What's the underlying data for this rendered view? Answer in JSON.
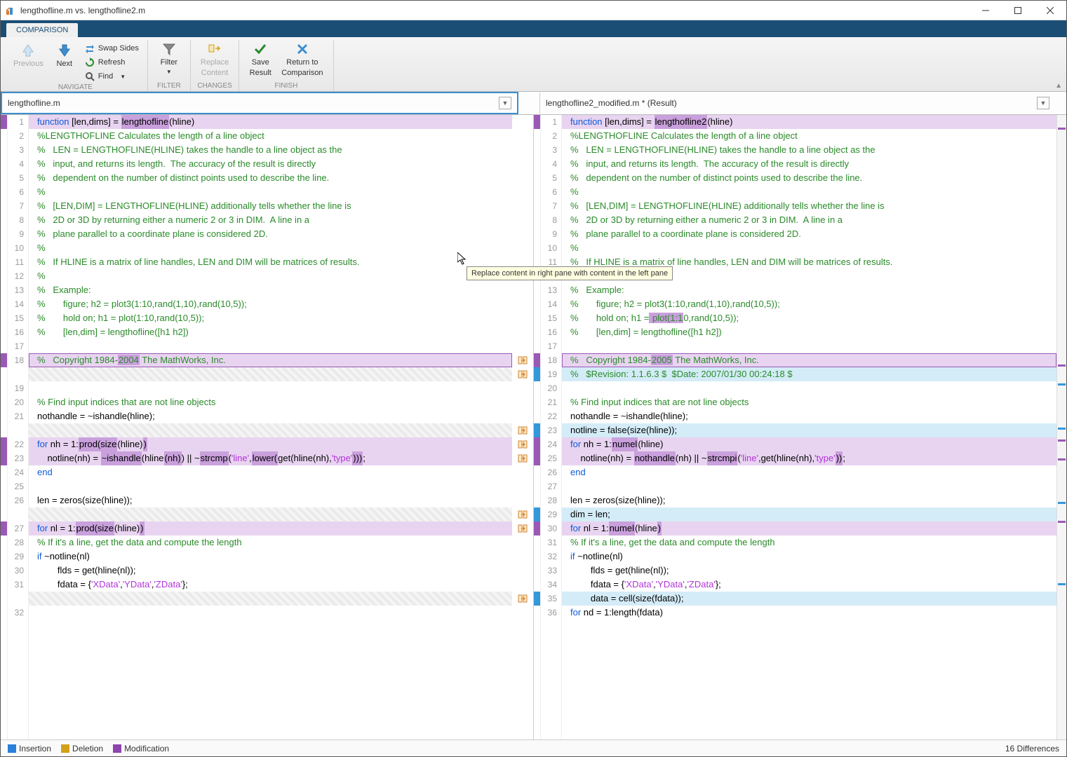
{
  "window": {
    "title": "lengthofline.m vs. lengthofline2.m"
  },
  "tabs": {
    "active": "COMPARISON"
  },
  "ribbon": {
    "navigate": {
      "previous": "Previous",
      "next": "Next",
      "swap": "Swap Sides",
      "refresh": "Refresh",
      "find": "Find",
      "label": "NAVIGATE"
    },
    "filter": {
      "btn": "Filter",
      "label": "FILTER"
    },
    "changes": {
      "replace1": "Replace",
      "replace2": "Content",
      "label": "CHANGES"
    },
    "finish": {
      "save1": "Save",
      "save2": "Result",
      "return1": "Return to",
      "return2": "Comparison",
      "label": "FINISH"
    }
  },
  "files": {
    "left": "lengthofline.m",
    "right": "lengthofline2_modified.m * (Result)"
  },
  "tooltip": "Replace content in right pane with content in the left pane",
  "status": {
    "insertion": "Insertion",
    "deletion": "Deletion",
    "modification": "Modification",
    "diffcount": "16 Differences"
  },
  "code": {
    "left": [
      {
        "n": 1,
        "mk": "mod",
        "bg": "mod",
        "html": "<span class='k-fn'>function</span> [len,dims] = <span class='hl'>lengthofline</span>(hline)"
      },
      {
        "n": 2,
        "html": "<span class='k-cm'>%LENGTHOFLINE Calculates the length of a line object</span>"
      },
      {
        "n": 3,
        "html": "<span class='k-cm'>%   LEN = LENGTHOFLINE(HLINE) takes the handle to a line object as the</span>"
      },
      {
        "n": 4,
        "html": "<span class='k-cm'>%   input, and returns its length.  The accuracy of the result is directly</span>"
      },
      {
        "n": 5,
        "html": "<span class='k-cm'>%   dependent on the number of distinct points used to describe the line.</span>"
      },
      {
        "n": 6,
        "html": "<span class='k-cm'>%</span>"
      },
      {
        "n": 7,
        "html": "<span class='k-cm'>%   [LEN,DIM] = LENGTHOFLINE(HLINE) additionally tells whether the line is</span>"
      },
      {
        "n": 8,
        "html": "<span class='k-cm'>%   2D or 3D by returning either a numeric 2 or 3 in DIM.  A line in a</span>"
      },
      {
        "n": 9,
        "html": "<span class='k-cm'>%   plane parallel to a coordinate plane is considered 2D.</span>"
      },
      {
        "n": 10,
        "html": "<span class='k-cm'>%</span>"
      },
      {
        "n": 11,
        "html": "<span class='k-cm'>%   If HLINE is a matrix of line handles, LEN and DIM will be matrices of results.</span>"
      },
      {
        "n": 12,
        "html": "<span class='k-cm'>%</span>"
      },
      {
        "n": 13,
        "html": "<span class='k-cm'>%   Example:</span>"
      },
      {
        "n": 14,
        "html": "<span class='k-cm'>%       figure; h2 = plot3(1:10,rand(1,10),rand(10,5));</span>"
      },
      {
        "n": 15,
        "html": "<span class='k-cm'>%       hold on; h1 = plot(1:10,rand(10,5));</span>"
      },
      {
        "n": 16,
        "html": "<span class='k-cm'>%       [len,dim] = lengthofline([h1 h2])</span>"
      },
      {
        "n": 17,
        "html": ""
      },
      {
        "n": 18,
        "mk": "mod",
        "bg": "sel",
        "merge": "right",
        "html": "<span class='k-cm'>%   Copyright 1984-<span class='hl'>2004</span> The MathWorks, Inc.</span>"
      },
      {
        "n": "",
        "bg": "gap",
        "merge": "right",
        "html": ""
      },
      {
        "n": 19,
        "html": ""
      },
      {
        "n": 20,
        "html": "<span class='k-cm'>% Find input indices that are not line objects</span>"
      },
      {
        "n": 21,
        "html": "nothandle = ~ishandle(hline);"
      },
      {
        "n": "",
        "bg": "gap",
        "merge": "right",
        "html": ""
      },
      {
        "n": 22,
        "mk": "mod",
        "bg": "mod",
        "merge": "right",
        "html": "<span class='k-kw'>for</span> nh = 1:<span class='hl'>prod(size</span>(hline)<span class='hl'>)</span>"
      },
      {
        "n": 23,
        "mk": "mod",
        "bg": "mod",
        "merge": "right",
        "html": "    notline(nh) = <span class='hl'>~ishandle</span>(hline<span class='hl'>(nh)</span>) || ~<span class='hl'>strcmp</span>(<span class='k-str'>'line'</span>,<span class='hl'>lower(</span>get(hline(nh),<span class='k-str'>'type'</span><span class='hl'>)))</span>;"
      },
      {
        "n": 24,
        "html": "<span class='k-kw'>end</span>"
      },
      {
        "n": 25,
        "html": ""
      },
      {
        "n": 26,
        "html": "len = zeros(size(hline));"
      },
      {
        "n": "",
        "bg": "gap",
        "merge": "right",
        "html": ""
      },
      {
        "n": 27,
        "mk": "mod",
        "bg": "mod",
        "merge": "right",
        "html": "<span class='k-kw'>for</span> nl = 1:<span class='hl'>prod(size</span>(hline)<span class='hl'>)</span>"
      },
      {
        "n": 28,
        "html": "    <span class='k-cm'>% If it's a line, get the data and compute the length</span>"
      },
      {
        "n": 29,
        "html": "    <span class='k-kw'>if</span> ~notline(nl)"
      },
      {
        "n": 30,
        "html": "        flds = get(hline(nl));"
      },
      {
        "n": 31,
        "html": "        fdata = {<span class='k-str'>'XData'</span>,<span class='k-str'>'YData'</span>,<span class='k-str'>'ZData'</span>};"
      },
      {
        "n": "",
        "bg": "gap",
        "merge": "right",
        "html": ""
      },
      {
        "n": 32,
        "html": ""
      }
    ],
    "right": [
      {
        "n": 1,
        "mk": "mod",
        "bg": "mod",
        "html": "<span class='k-fn'>function</span> [len,dims] = <span class='hl'>lengthofline2</span>(hline)"
      },
      {
        "n": 2,
        "html": "<span class='k-cm'>%LENGTHOFLINE Calculates the length of a line object</span>"
      },
      {
        "n": 3,
        "html": "<span class='k-cm'>%   LEN = LENGTHOFLINE(HLINE) takes the handle to a line object as the</span>"
      },
      {
        "n": 4,
        "html": "<span class='k-cm'>%   input, and returns its length.  The accuracy of the result is directly</span>"
      },
      {
        "n": 5,
        "html": "<span class='k-cm'>%   dependent on the number of distinct points used to describe the line.</span>"
      },
      {
        "n": 6,
        "html": "<span class='k-cm'>%</span>"
      },
      {
        "n": 7,
        "html": "<span class='k-cm'>%   [LEN,DIM] = LENGTHOFLINE(HLINE) additionally tells whether the line is</span>"
      },
      {
        "n": 8,
        "html": "<span class='k-cm'>%   2D or 3D by returning either a numeric 2 or 3 in DIM.  A line in a</span>"
      },
      {
        "n": 9,
        "html": "<span class='k-cm'>%   plane parallel to a coordinate plane is considered 2D.</span>"
      },
      {
        "n": 10,
        "html": "<span class='k-cm'>%</span>"
      },
      {
        "n": 11,
        "html": "<span class='k-cm'>%   If HLINE is a matrix of line handles, LEN and DIM will be matrices of results.</span>"
      },
      {
        "n": 12,
        "html": "<span class='k-cm'>%</span>"
      },
      {
        "n": 13,
        "html": "<span class='k-cm'>%   Example:</span>"
      },
      {
        "n": 14,
        "html": "<span class='k-cm'>%       figure; h2 = plot3(1:10,rand(1,10),rand(10,5));</span>"
      },
      {
        "n": 15,
        "html": "<span class='k-cm'>%       hold on; h1 =<span class='hl'> plot(1:1</span>0,rand(10,5));</span>"
      },
      {
        "n": 16,
        "html": "<span class='k-cm'>%       [len,dim] = lengthofline([h1 h2])</span>"
      },
      {
        "n": 17,
        "html": ""
      },
      {
        "n": 18,
        "mk": "mod",
        "bg": "sel",
        "html": "<span class='k-cm'>%   Copyright 1984-<span class='hl'>2005</span> The MathWorks, Inc.</span>"
      },
      {
        "n": 19,
        "mk": "ins",
        "bg": "ins",
        "html": "<span class='k-cm'>%   $Revision: 1.1.6.3 $  $Date: 2007/01/30 00:24:18 $</span>"
      },
      {
        "n": 20,
        "html": ""
      },
      {
        "n": 21,
        "html": "<span class='k-cm'>% Find input indices that are not line objects</span>"
      },
      {
        "n": 22,
        "html": "nothandle = ~ishandle(hline);"
      },
      {
        "n": 23,
        "mk": "ins",
        "bg": "ins",
        "merge": "left",
        "html": "notline = false(size(hline));"
      },
      {
        "n": 24,
        "mk": "mod",
        "bg": "mod",
        "merge": "left",
        "html": "<span class='k-kw'>for</span> nh = 1:<span class='hl'>numel</span>(hline)"
      },
      {
        "n": 25,
        "mk": "mod",
        "bg": "mod",
        "merge": "left",
        "html": "    notline(nh) = <span class='hl'>nothandle</span>(nh) || ~<span class='hl'>strcmpi</span>(<span class='k-str'>'line'</span>,get(hline(nh),<span class='k-str'>'type'</span><span class='hl'>))</span>;"
      },
      {
        "n": 26,
        "html": "<span class='k-kw'>end</span>"
      },
      {
        "n": 27,
        "html": ""
      },
      {
        "n": 28,
        "html": "len = zeros(size(hline));"
      },
      {
        "n": 29,
        "mk": "ins",
        "bg": "ins",
        "merge": "left",
        "html": "dim = len;"
      },
      {
        "n": 30,
        "mk": "mod",
        "bg": "mod",
        "merge": "left",
        "html": "<span class='k-kw'>for</span> nl = 1:<span class='hl'>numel</span>(hline<span class='hl'>)</span>"
      },
      {
        "n": 31,
        "html": "    <span class='k-cm'>% If it's a line, get the data and compute the length</span>"
      },
      {
        "n": 32,
        "html": "    <span class='k-kw'>if</span> ~notline(nl)"
      },
      {
        "n": 33,
        "html": "        flds = get(hline(nl));"
      },
      {
        "n": 34,
        "html": "        fdata = {<span class='k-str'>'XData'</span>,<span class='k-str'>'YData'</span>,<span class='k-str'>'ZData'</span>};"
      },
      {
        "n": 35,
        "mk": "ins",
        "bg": "ins",
        "merge": "left",
        "html": "        data = cell(size(fdata));"
      },
      {
        "n": 36,
        "html": "        <span class='k-kw'>for</span> nd = 1:length(fdata)"
      }
    ]
  }
}
